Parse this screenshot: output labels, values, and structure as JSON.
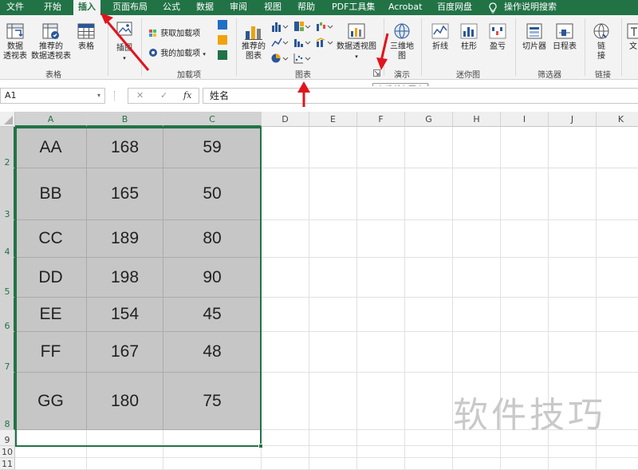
{
  "tabs": [
    "文件",
    "开始",
    "插入",
    "页面布局",
    "公式",
    "数据",
    "审阅",
    "视图",
    "帮助",
    "PDF工具集",
    "Acrobat",
    "百度网盘",
    "操作说明搜索"
  ],
  "ribbon": {
    "tables": {
      "pivot": "数据\n透视表",
      "recommended_pivot": "推荐的\n数据透视表",
      "table": "表格",
      "label": "表格"
    },
    "illustrations": {
      "label": "插图"
    },
    "addins": {
      "get": "获取加载项",
      "my": "我的加载项",
      "label": "加载项"
    },
    "charts": {
      "recommended": "推荐的\n图表",
      "pivot_chart": "数据透视图",
      "label": "图表"
    },
    "tours": {
      "map3d": "三维地\n图",
      "label": "演示"
    },
    "sparklines": {
      "line": "折线",
      "column": "柱形",
      "winloss": "盈亏",
      "label": "迷你图"
    },
    "filters": {
      "slicer": "切片器",
      "timeline": "日程表",
      "label": "筛选器"
    },
    "links": {
      "link": "链\n接",
      "label": "链接"
    },
    "text": {
      "label": "文"
    }
  },
  "tooltip": "查看所有图表",
  "formula_bar": {
    "name_box": "A1",
    "cancel": "✕",
    "enter": "✓",
    "fx": "fx",
    "content": "姓名"
  },
  "columns": [
    "A",
    "B",
    "C",
    "D",
    "E",
    "F",
    "G",
    "H",
    "I",
    "J",
    "K"
  ],
  "rows": [
    {
      "num": "2",
      "cells": [
        "AA",
        "168",
        "59"
      ]
    },
    {
      "num": "3",
      "cells": [
        "BB",
        "165",
        "50"
      ]
    },
    {
      "num": "4",
      "cells": [
        "CC",
        "189",
        "80"
      ]
    },
    {
      "num": "5",
      "cells": [
        "DD",
        "198",
        "90"
      ]
    },
    {
      "num": "6",
      "cells": [
        "EE",
        "154",
        "45"
      ]
    },
    {
      "num": "7",
      "cells": [
        "FF",
        "167",
        "48"
      ]
    },
    {
      "num": "8",
      "cells": [
        "GG",
        "180",
        "75"
      ]
    },
    {
      "num": "9",
      "cells": [
        "",
        "",
        ""
      ]
    },
    {
      "num": "10",
      "cells": [
        "",
        "",
        ""
      ]
    },
    {
      "num": "11",
      "cells": [
        "",
        "",
        ""
      ]
    }
  ],
  "watermark": "软件技巧",
  "colors": {
    "excel_green": "#217346",
    "arrow_red": "#e0141e",
    "selection_fill": "#c6c6c6"
  }
}
